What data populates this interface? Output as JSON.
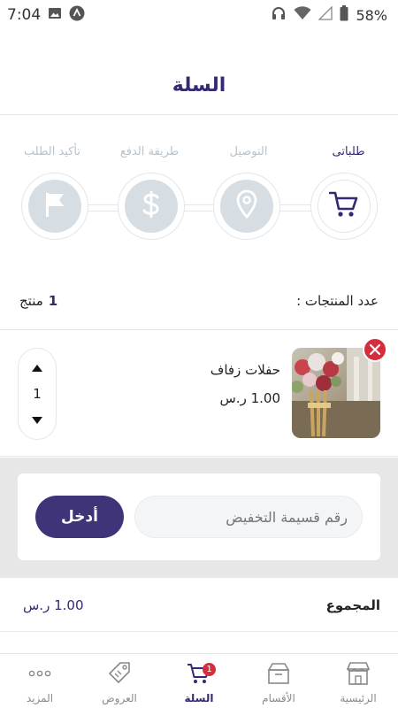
{
  "status_bar": {
    "time": "7:04",
    "battery": "58%",
    "icons": [
      "image-icon",
      "circle-a-icon",
      "headphones-icon",
      "wifi-icon",
      "signal-icon",
      "battery-icon"
    ]
  },
  "header": {
    "title": "السلة"
  },
  "steps": [
    {
      "label": "طلباتى",
      "icon": "cart-icon",
      "active": true
    },
    {
      "label": "التوصيل",
      "icon": "location-pin-icon",
      "active": false
    },
    {
      "label": "طريقة الدفع",
      "icon": "dollar-icon",
      "active": false
    },
    {
      "label": "تأكيد الطلب",
      "icon": "flag-icon",
      "active": false
    }
  ],
  "summary": {
    "count_label": "عدد المنتجات :",
    "count_num": "1",
    "count_unit": "منتج"
  },
  "cart_item": {
    "name": "حفلات زفاف",
    "price": "1.00 ر.س",
    "quantity": "1"
  },
  "coupon": {
    "placeholder": "رقم قسيمة التخفيض",
    "apply_label": "أدخل"
  },
  "total": {
    "label": "المجموع",
    "value": "1.00 ر.س"
  },
  "bottom_nav": {
    "items": [
      {
        "label": "الرئيسية",
        "icon": "store-icon"
      },
      {
        "label": "الأقسام",
        "icon": "box-icon"
      },
      {
        "label": "السلة",
        "icon": "cart-icon",
        "badge": "1",
        "active": true
      },
      {
        "label": "العروض",
        "icon": "tag-icon"
      },
      {
        "label": "المزيد",
        "icon": "more-dots-icon"
      }
    ]
  },
  "colors": {
    "primary": "#322b73",
    "button": "#3f3478",
    "danger": "#d62d3c",
    "step_inactive": "#d6dde3"
  }
}
